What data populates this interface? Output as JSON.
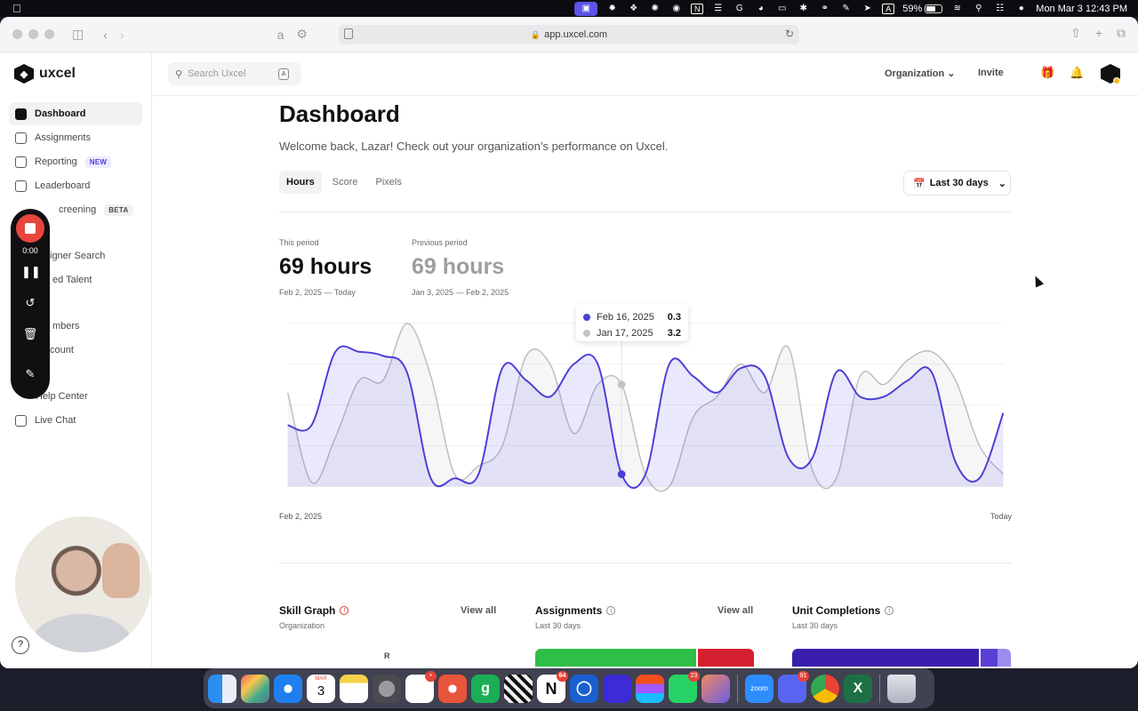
{
  "menubar": {
    "battery": "59%",
    "datetime": "Mon Mar 3  12:43 PM",
    "icons": [
      "screen-record-icon",
      "gear-icon",
      "grid-icon",
      "sparkle-icon",
      "zoom-icon",
      "notion-icon",
      "waveform-icon",
      "grammarly-icon",
      "coffee-icon",
      "display-icon",
      "bluetooth-icon",
      "headphones-icon",
      "pen-icon",
      "cursor-icon",
      "input-a-icon",
      "wifi-icon",
      "search-icon",
      "control-center-icon",
      "siri-icon"
    ]
  },
  "browser": {
    "url": "app.uxcel.com"
  },
  "app": {
    "brand": "uxcel",
    "search_placeholder": "Search Uxcel",
    "org_label": "Organization",
    "invite_label": "Invite"
  },
  "sidebar": {
    "items": [
      {
        "label": "Dashboard",
        "icon": "dashboard-icon"
      },
      {
        "label": "Assignments",
        "icon": "checklist-icon"
      },
      {
        "label": "Reporting",
        "icon": "reporting-icon",
        "badge": "NEW"
      },
      {
        "label": "Leaderboard",
        "icon": "bar-chart-icon"
      },
      {
        "label": "Screening",
        "icon": "screening-icon",
        "badge": "BETA"
      },
      {
        "label": "Designer Search",
        "icon": "search-icon"
      },
      {
        "label": "Saved Talent",
        "icon": "bookmark-icon"
      },
      {
        "label": "Members",
        "icon": "members-icon"
      },
      {
        "label": "Account",
        "icon": "account-icon"
      },
      {
        "label": "Help Center",
        "icon": "help-icon"
      },
      {
        "label": "Live Chat",
        "icon": "chat-icon"
      }
    ],
    "visible_labels": [
      "Dashboard",
      "Assignments",
      "Reporting",
      "Leaderboard",
      "creening",
      "igner Search",
      "ed Talent",
      "mbers",
      "count",
      "Help Center",
      "Live Chat"
    ]
  },
  "recorder": {
    "time": "0:00"
  },
  "dashboard": {
    "title": "Dashboard",
    "welcome": "Welcome back, Lazar! Check out your organization’s performance on Uxcel.",
    "tabs": [
      "Hours",
      "Score",
      "Pixels"
    ],
    "active_tab": "Hours",
    "range_label": "Last 30 days",
    "this_period": {
      "label": "This period",
      "value": "69 hours",
      "range": "Feb 2, 2025 — Today"
    },
    "prev_period": {
      "label": "Previous period",
      "value": "69 hours",
      "range": "Jan 3, 2025 — Feb 2, 2025"
    },
    "tooltip": [
      {
        "date": "Feb 16, 2025",
        "value": "0.3",
        "color": "#4a3fd6"
      },
      {
        "date": "Jan 17, 2025",
        "value": "3.2",
        "color": "#c3c3c7"
      }
    ],
    "x_start": "Feb 2, 2025",
    "x_end": "Today"
  },
  "chart_data": {
    "type": "area",
    "ylim": [
      0,
      4
    ],
    "hovered_index": 14,
    "x_start_label": "Feb 2, 2025",
    "x_end_label": "Today",
    "series": [
      {
        "color": "#4a3fd6",
        "values": [
          1.5,
          1.5,
          3.3,
          3.3,
          3.2,
          2.8,
          0.2,
          0.2,
          0.3,
          2.9,
          2.6,
          2.2,
          3.0,
          3.0,
          0.3,
          0.3,
          3.0,
          2.7,
          2.3,
          2.9,
          2.7,
          0.7,
          0.7,
          2.8,
          2.2,
          2.2,
          2.6,
          2.8,
          0.6,
          0.2,
          1.8
        ]
      },
      {
        "color": "#bdbdc2",
        "values": [
          2.3,
          0.1,
          1.2,
          2.6,
          2.6,
          4.0,
          2.7,
          0.3,
          0.5,
          1.0,
          3.2,
          3.0,
          1.3,
          2.5,
          2.5,
          0.3,
          0.0,
          1.7,
          2.2,
          3.0,
          2.3,
          3.4,
          0.4,
          0.2,
          2.7,
          2.5,
          3.1,
          3.3,
          2.6,
          1.0,
          0.3
        ]
      }
    ]
  },
  "cards": {
    "skill_graph": {
      "title": "Skill Graph",
      "sub": "Organization",
      "view_all": "View all",
      "radar_top": "R"
    },
    "assignments": {
      "title": "Assignments",
      "sub": "Last 30 days",
      "view_all": "View all"
    },
    "unit_completions": {
      "title": "Unit Completions",
      "sub": "Last 30 days"
    }
  },
  "dock": {
    "calendar_month": "MAR",
    "calendar_day": "3",
    "badges": {
      "slack": "",
      "notion": "64",
      "whatsapp": "23",
      "discord": "91"
    },
    "zoom_label": "zoom"
  }
}
